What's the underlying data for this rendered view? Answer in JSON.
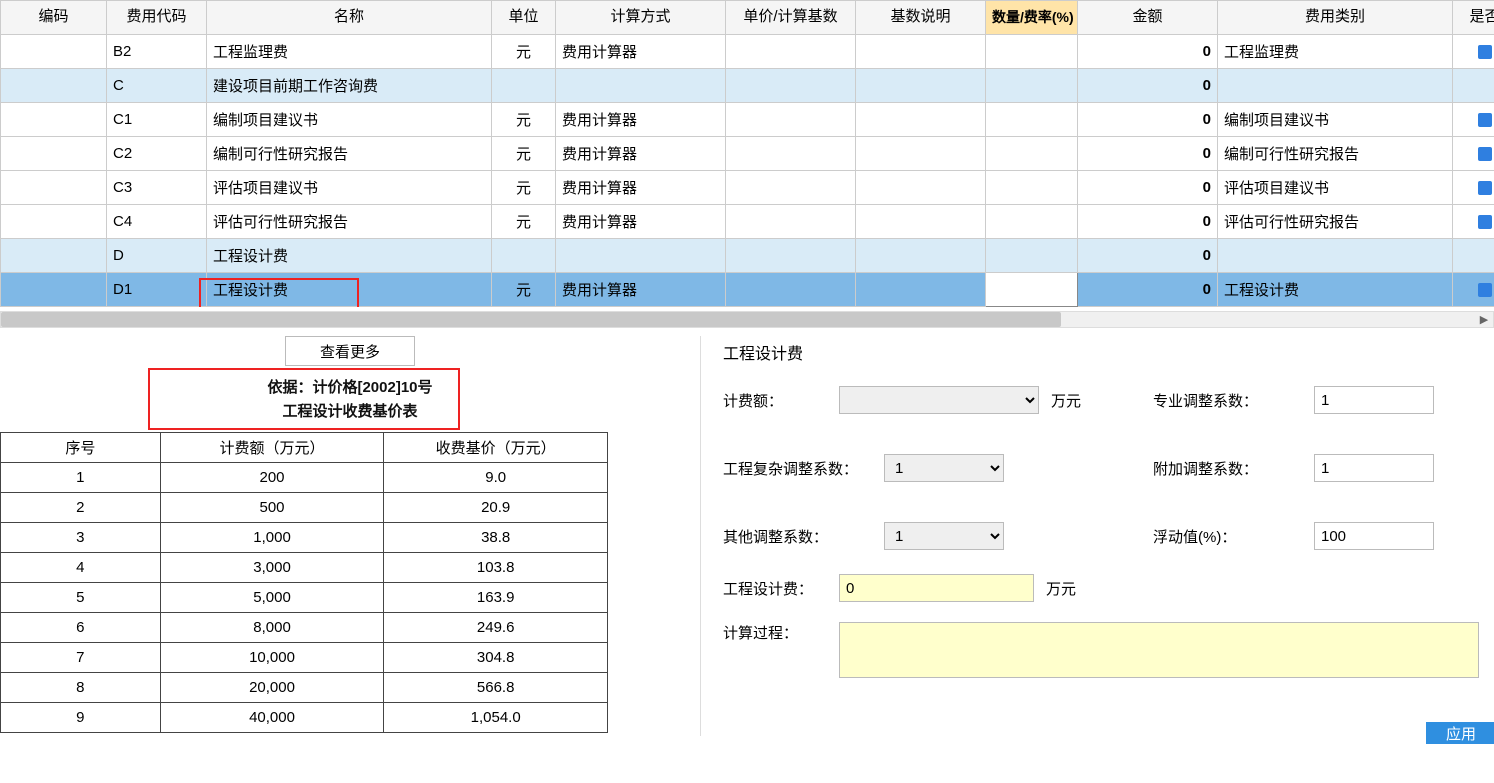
{
  "columns": {
    "code": "编码",
    "feeCode": "费用代码",
    "name": "名称",
    "unit": "单位",
    "calcMethod": "计算方式",
    "unitBase": "单价/计算基数",
    "baseDesc": "基数说明",
    "qtyRate": "数量/费率(%)",
    "amount": "金额",
    "feeType": "费用类别",
    "isFlag": "是否"
  },
  "rows": [
    {
      "code": "",
      "feeCode": "B2",
      "name": "工程监理费",
      "unit": "元",
      "calc": "费用计算器",
      "amount": "0",
      "type": "工程监理费",
      "group": false,
      "chk": true
    },
    {
      "code": "",
      "feeCode": "C",
      "name": "建设项目前期工作咨询费",
      "unit": "",
      "calc": "",
      "amount": "0",
      "type": "",
      "group": true,
      "chk": false
    },
    {
      "code": "",
      "feeCode": "C1",
      "name": "编制项目建议书",
      "unit": "元",
      "calc": "费用计算器",
      "amount": "0",
      "type": "编制项目建议书",
      "group": false,
      "chk": true
    },
    {
      "code": "",
      "feeCode": "C2",
      "name": "编制可行性研究报告",
      "unit": "元",
      "calc": "费用计算器",
      "amount": "0",
      "type": "编制可行性研究报告",
      "group": false,
      "chk": true
    },
    {
      "code": "",
      "feeCode": "C3",
      "name": "评估项目建议书",
      "unit": "元",
      "calc": "费用计算器",
      "amount": "0",
      "type": "评估项目建议书",
      "group": false,
      "chk": true
    },
    {
      "code": "",
      "feeCode": "C4",
      "name": "评估可行性研究报告",
      "unit": "元",
      "calc": "费用计算器",
      "amount": "0",
      "type": "评估可行性研究报告",
      "group": false,
      "chk": true
    },
    {
      "code": "",
      "feeCode": "D",
      "name": "工程设计费",
      "unit": "",
      "calc": "",
      "amount": "0",
      "type": "",
      "group": true,
      "chk": false
    },
    {
      "code": "",
      "feeCode": "D1",
      "name": "工程设计费",
      "unit": "元",
      "calc": "费用计算器",
      "amount": "0",
      "type": "工程设计费",
      "group": false,
      "chk": true,
      "selected": true
    }
  ],
  "viewMore": "查看更多",
  "basis": {
    "line1": "依据：计价格[2002]10号",
    "line2": "工程设计收费基价表"
  },
  "priceTable": {
    "headers": {
      "seq": "序号",
      "amt": "计费额（万元）",
      "base": "收费基价（万元）"
    },
    "rows": [
      {
        "seq": "1",
        "amt": "200",
        "base": "9.0"
      },
      {
        "seq": "2",
        "amt": "500",
        "base": "20.9"
      },
      {
        "seq": "3",
        "amt": "1,000",
        "base": "38.8"
      },
      {
        "seq": "4",
        "amt": "3,000",
        "base": "103.8"
      },
      {
        "seq": "5",
        "amt": "5,000",
        "base": "163.9"
      },
      {
        "seq": "6",
        "amt": "8,000",
        "base": "249.6"
      },
      {
        "seq": "7",
        "amt": "10,000",
        "base": "304.8"
      },
      {
        "seq": "8",
        "amt": "20,000",
        "base": "566.8"
      },
      {
        "seq": "9",
        "amt": "40,000",
        "base": "1,054.0"
      }
    ]
  },
  "rightPanel": {
    "title": "工程设计费",
    "labels": {
      "feeAmount": "计费额：",
      "unitWan": "万元",
      "proCoef": "专业调整系数：",
      "complexCoef": "工程复杂调整系数：",
      "addCoef": "附加调整系数：",
      "otherCoef": "其他调整系数：",
      "floatVal": "浮动值(%)：",
      "designFee": "工程设计费：",
      "calcProc": "计算过程："
    },
    "values": {
      "feeAmount": "",
      "proCoef": "1",
      "complexCoef": "1",
      "addCoef": "1",
      "otherCoef": "1",
      "floatVal": "100",
      "designFee": "0",
      "calcProc": ""
    },
    "applyBtn": "应用"
  }
}
